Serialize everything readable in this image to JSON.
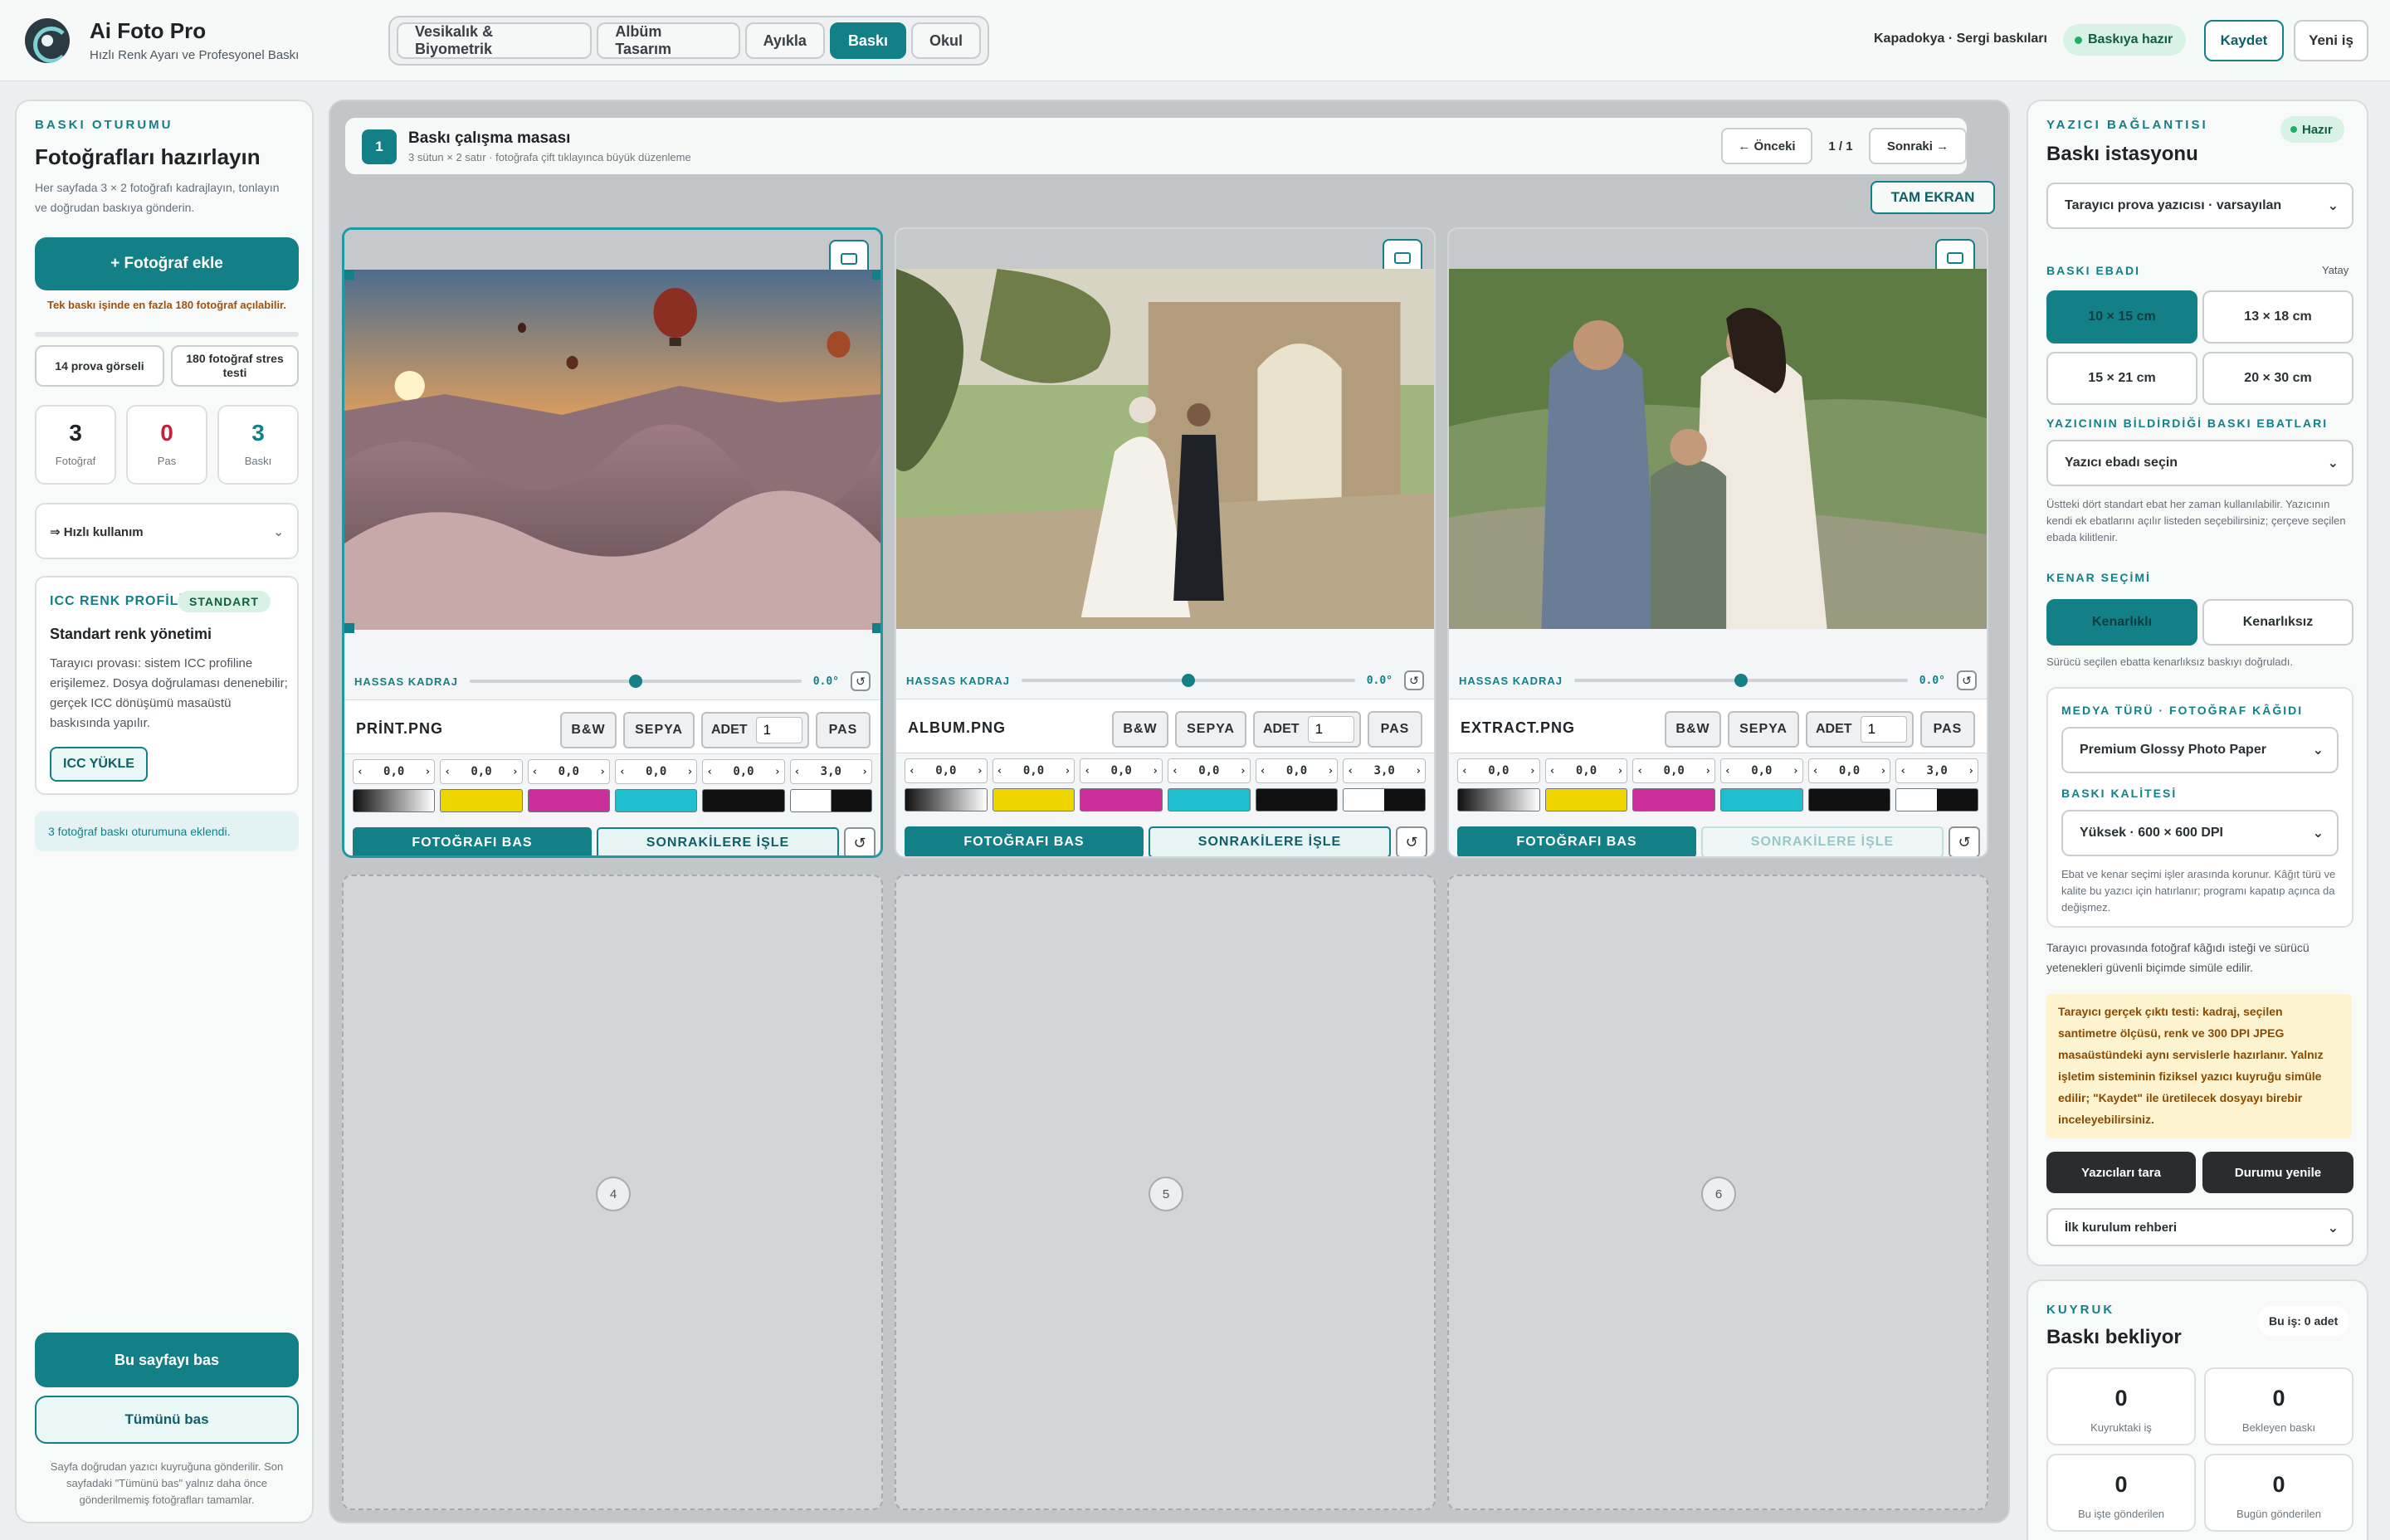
{
  "header": {
    "title": "Ai Foto Pro",
    "subtitle": "Hızlı Renk Ayarı ve Profesyonel Baskı",
    "tabs": [
      {
        "label": "Vesikalık & Biyometrik",
        "active": false
      },
      {
        "label": "Albüm Tasarım",
        "active": false
      },
      {
        "label": "Ayıkla",
        "active": false
      },
      {
        "label": "Baskı",
        "active": true
      },
      {
        "label": "Okul",
        "active": false
      }
    ],
    "session": "Kapadokya · Sergi baskıları",
    "status": "Baskıya hazır",
    "save": "Kaydet",
    "new_job": "Yeni iş"
  },
  "left": {
    "eyebrow": "BASKI OTURUMU",
    "title": "Fotoğrafları hazırlayın",
    "description": "Her sayfada 3 × 2 fotoğrafı kadrajlayın, tonlayın ve doğrudan baskıya gönderin.",
    "add_photo": "+ Fotoğraf ekle",
    "limit_note": "Tek baskı işinde en fazla 180 fotoğraf açılabilir.",
    "proof_btn": "14 prova görseli",
    "stress_btn": "180 fotoğraf stres testi",
    "stats": [
      {
        "value": "3",
        "label": "Fotoğraf",
        "color": "#1d2327"
      },
      {
        "value": "0",
        "label": "Pas",
        "color": "#c0213f"
      },
      {
        "value": "3",
        "label": "Baskı",
        "color": "#137f87"
      }
    ],
    "quick_use": "⇒ Hızlı kullanım",
    "icc": {
      "eyebrow": "ICC RENK PROFİLİ",
      "badge": "STANDART",
      "title": "Standart renk yönetimi",
      "text": "Tarayıcı provası: sistem ICC profiline erişilemez. Dosya doğrulaması denenebilir; gerçek ICC dönüşümü masaüstü baskısında yapılır.",
      "load": "ICC YÜKLE"
    },
    "added_note": "3 fotoğraf baskı oturumuna eklendi.",
    "print_page": "Bu sayfayı bas",
    "print_all": "Tümünü bas",
    "footer_note": "Sayfa doğrudan yazıcı kuyruğuna gönderilir. Son sayfadaki \"Tümünü bas\" yalnız daha önce gönderilmemiş fotoğrafları tamamlar."
  },
  "main": {
    "page_number": "1",
    "title": "Baskı çalışma masası",
    "subtitle": "3 sütun × 2 satır · fotoğrafa çift tıklayınca büyük düzenleme",
    "prev": "← Önceki",
    "page_indicator": "1 / 1",
    "next": "Sonraki →",
    "fullscreen": "TAM EKRAN",
    "labels": {
      "crop": "HASSAS KADRAJ",
      "bw": "B&W",
      "sepia": "SEPYA",
      "qty": "ADET",
      "pass": "PAS",
      "print": "FOTOĞRAFI BAS",
      "apply": "SONRAKİLERE İŞLE"
    },
    "cards": [
      {
        "file": "PRİNT.PNG",
        "rotation": "0.0°",
        "qty": "1",
        "slider": 0.5,
        "adjust": [
          "0,0",
          "0,0",
          "0,0",
          "0,0",
          "0,0",
          "3,0"
        ],
        "apply_enabled": true
      },
      {
        "file": "ALBUM.PNG",
        "rotation": "0.0°",
        "qty": "1",
        "slider": 0.5,
        "adjust": [
          "0,0",
          "0,0",
          "0,0",
          "0,0",
          "0,0",
          "3,0"
        ],
        "apply_enabled": true
      },
      {
        "file": "EXTRACT.PNG",
        "rotation": "0.0°",
        "qty": "1",
        "slider": 0.5,
        "adjust": [
          "0,0",
          "0,0",
          "0,0",
          "0,0",
          "0,0",
          "3,0"
        ],
        "apply_enabled": false
      }
    ],
    "empty_slots": [
      "4",
      "5",
      "6"
    ]
  },
  "right": {
    "eyebrow": "YAZICI BAĞLANTISI",
    "status": "Hazır",
    "title": "Baskı istasyonu",
    "printer": "Tarayıcı prova yazıcısı · varsayılan",
    "size_label": "BASKI EBADI",
    "orientation": "Yatay",
    "sizes": [
      {
        "label": "10 × 15 cm",
        "active": true
      },
      {
        "label": "13 × 18 cm",
        "active": false
      },
      {
        "label": "15 × 21 cm",
        "active": false
      },
      {
        "label": "20 × 30 cm",
        "active": false
      }
    ],
    "reported_label": "YAZICININ BİLDİRDİĞİ BASKI EBATLARI",
    "reported_select": "Yazıcı ebadı seçin",
    "reported_note": "Üstteki dört standart ebat her zaman kullanılabilir. Yazıcının kendi ek ebatlarını açılır listeden seçebilirsiniz; çerçeve seçilen ebada kilitlenir.",
    "border_label": "KENAR SEÇİMİ",
    "border_opts": [
      {
        "label": "Kenarlıklı",
        "active": true
      },
      {
        "label": "Kenarlıksız",
        "active": false
      }
    ],
    "border_note": "Sürücü seçilen ebatta kenarlıksız baskıyı doğruladı.",
    "media_label": "MEDYA TÜRÜ · FOTOĞRAF KÂĞIDI",
    "media": "Premium Glossy Photo Paper",
    "quality_label": "BASKI KALİTESİ",
    "quality": "Yüksek · 600 × 600 DPI",
    "quality_note": "Ebat ve kenar seçimi işler arasında korunur. Kâğıt türü ve kalite bu yazıcı için hatırlanır; programı kapatıp açınca da değişmez.",
    "sim_note": "Tarayıcı provasında fotoğraf kâğıdı isteği ve sürücü yetenekleri güvenli biçimde simüle edilir.",
    "warning": "Tarayıcı gerçek çıktı testi: kadraj, seçilen santimetre ölçüsü, renk ve 300 DPI JPEG masaüstündeki aynı servislerle hazırlanır. Yalnız işletim sisteminin fiziksel yazıcı kuyruğu simüle edilir; \"Kaydet\" ile üretilecek dosyayı birebir inceleyebilirsiniz.",
    "scan": "Yazıcıları tara",
    "refresh": "Durumu yenile",
    "guide": "İlk kurulum rehberi"
  },
  "queue": {
    "eyebrow": "KUYRUK",
    "title": "Baskı bekliyor",
    "badge": "Bu iş: 0 adet",
    "stats": [
      {
        "value": "0",
        "label": "Kuyruktaki iş"
      },
      {
        "value": "0",
        "label": "Bekleyen baskı"
      },
      {
        "value": "0",
        "label": "Bu işte gönderilen"
      },
      {
        "value": "0",
        "label": "Bugün gönderilen"
      }
    ]
  },
  "colors": {
    "accent": "#137f87",
    "pass": "#c0213f",
    "yellow": "#efd500",
    "magenta": "#cc2f9b",
    "cyan": "#1fbfcf"
  }
}
